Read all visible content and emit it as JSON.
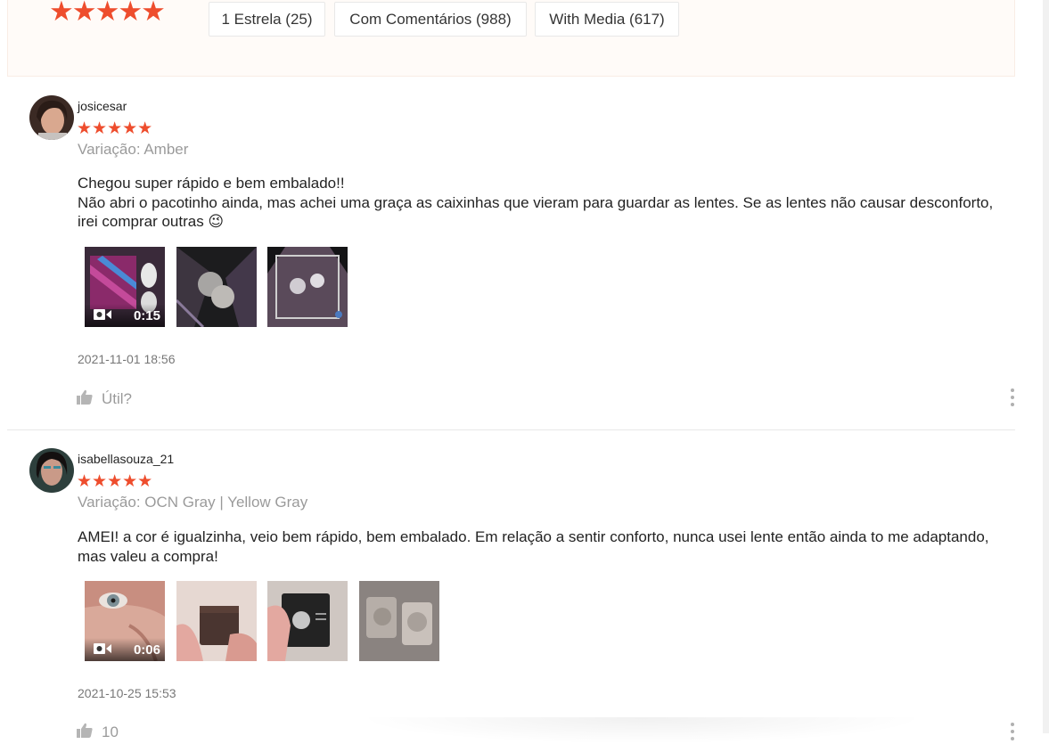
{
  "summary": {
    "stars": "★★★★★",
    "filters": [
      "1 Estrela (25)",
      "Com Comentários (988)",
      "With Media (617)"
    ]
  },
  "colors": {
    "accent": "#ee4d2d",
    "summary_bg": "#fffbf8"
  },
  "reviews": [
    {
      "username": "josicesar",
      "stars": "★★★★★",
      "variation": "Variação: Amber",
      "comment_lines": [
        "Chegou super rápido e bem embalado!!",
        "Não abri o pacotinho ainda, mas achei uma graça as caixinhas que vieram para guardar as lentes. Se as lentes não causar desconforto, irei comprar outras 😉"
      ],
      "video_duration": "0:15",
      "timestamp": "2021-11-01 18:56",
      "helpful_label": "Útil?"
    },
    {
      "username": "isabellasouza_21",
      "stars": "★★★★★",
      "variation": "Variação: OCN Gray | Yellow Gray",
      "comment_lines": [
        "AMEI! a cor é igualzinha, veio bem rápido, bem embalado. Em relação a sentir conforto, nunca usei lente então ainda to me adaptando, mas valeu a compra!"
      ],
      "video_duration": "0:06",
      "timestamp": "2021-10-25 15:53",
      "helpful_label": "10"
    }
  ]
}
